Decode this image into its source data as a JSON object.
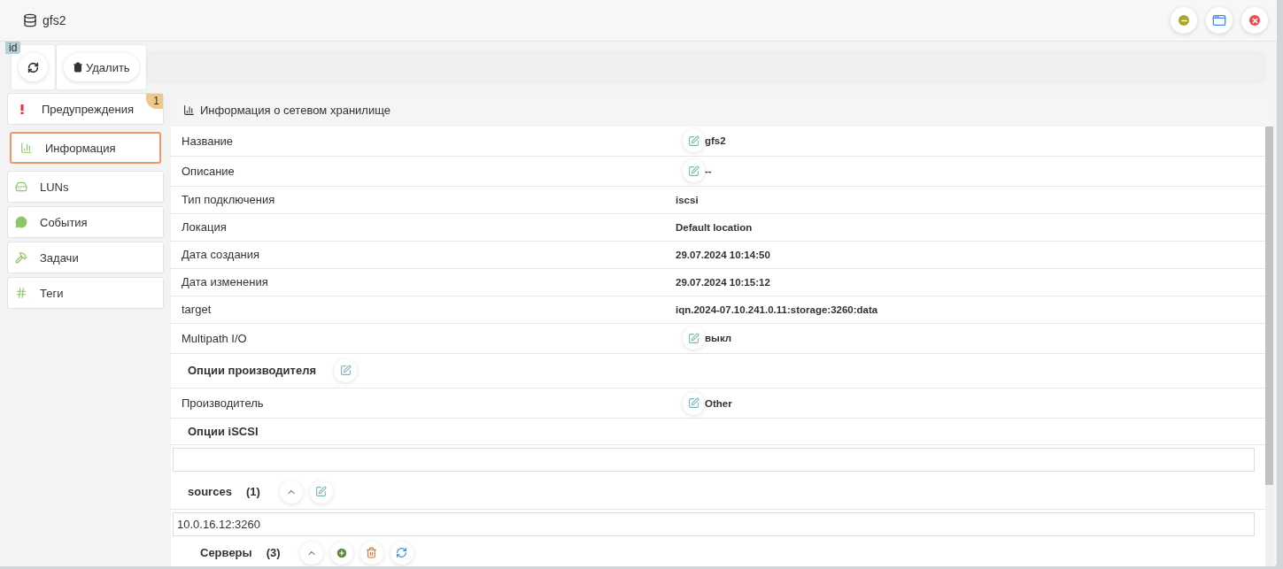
{
  "window": {
    "title": "gfs2"
  },
  "id_tag": "id",
  "toolbar": [
    {
      "kind": "refresh"
    },
    {
      "kind": "delete",
      "label": "Удалить"
    }
  ],
  "sidebar": {
    "items": [
      {
        "label": "Предупреждения",
        "selected": false,
        "badge": "1"
      },
      {
        "label": "Информация",
        "selected": true
      },
      {
        "label": "LUNs",
        "selected": false
      },
      {
        "label": "События",
        "selected": false
      },
      {
        "label": "Задачи",
        "selected": false
      },
      {
        "label": "Теги",
        "selected": false
      }
    ]
  },
  "panel": {
    "title": "Информация о сетевом хранилище",
    "rows": [
      {
        "kind": "property",
        "label": "Название",
        "value": "gfs2",
        "editable": true
      },
      {
        "kind": "property",
        "label": "Описание",
        "value": "--",
        "editable": true
      },
      {
        "kind": "property",
        "label": "Тип подключения",
        "value": "iscsi",
        "editable": false
      },
      {
        "kind": "property",
        "label": "Локация",
        "value": "Default location",
        "editable": false
      },
      {
        "kind": "property",
        "label": "Дата создания",
        "value": "29.07.2024 10:14:50",
        "editable": false
      },
      {
        "kind": "property",
        "label": "Дата изменения",
        "value": "29.07.2024 10:15:12",
        "editable": false
      },
      {
        "kind": "property",
        "label": "target",
        "value": "iqn.2024-07.10.241.0.11:storage:3260:data",
        "editable": false
      },
      {
        "kind": "property",
        "label": "Multipath I/O",
        "value": "выкл",
        "editable": true
      },
      {
        "kind": "section",
        "title": "Опции производителя",
        "editable": true
      },
      {
        "kind": "property",
        "label": "Производитель",
        "value": "Other",
        "editable": true
      },
      {
        "kind": "section",
        "title": "Опции iSCSI",
        "editable": false
      },
      {
        "kind": "field"
      },
      {
        "kind": "group",
        "title": "sources",
        "count": "(1)"
      },
      {
        "kind": "field",
        "value": "10.0.16.12:3260"
      },
      {
        "kind": "subgroup",
        "title": "Серверы",
        "count": "(3)"
      }
    ]
  }
}
